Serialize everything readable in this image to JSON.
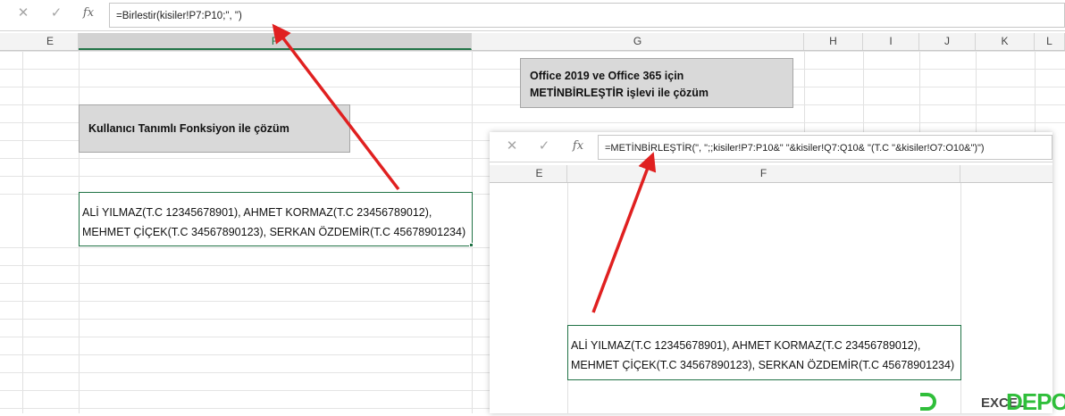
{
  "main_window": {
    "cancel_icon": "✕",
    "enter_icon": "✓",
    "fx_label": "fx",
    "formula": "=Birlestir(kisiler!P7:P10;\", \")",
    "columns": [
      "E",
      "F",
      "G",
      "H",
      "I",
      "J",
      "K",
      "L"
    ],
    "label_box": "Kullanıcı Tanımlı Fonksiyon ile çözüm",
    "result_line1": "ALİ YILMAZ(T.C 12345678901), AHMET KORMAZ(T.C 23456789012),",
    "result_line2": "MEHMET ÇİÇEK(T.C 34567890123), SERKAN ÖZDEMİR(T.C 45678901234)"
  },
  "office_box": {
    "line1": "Office 2019 ve Office 365 için",
    "line2": "METİNBİRLEŞTİR  işlevi ile çözüm"
  },
  "inset_window": {
    "cancel_icon": "✕",
    "enter_icon": "✓",
    "fx_label": "fx",
    "formula": "=METİNBİRLEŞTİR(\", \";;kisiler!P7:P10&\" \"&kisiler!Q7:Q10& \"(T.C \"&kisiler!O7:O10&\")\")",
    "columns": [
      "E",
      "F"
    ],
    "result_line1": "ALİ YILMAZ(T.C 12345678901), AHMET KORMAZ(T.C 23456789012),",
    "result_line2": "MEHMET ÇİÇEK(T.C 34567890123), SERKAN ÖZDEMİR(T.C 45678901234)"
  },
  "watermark": {
    "text": "DEPO",
    "sub": "EXCEL"
  },
  "colors": {
    "excel_green": "#217346",
    "arrow_red": "#e02020",
    "logo_green": "#2fbe3a"
  }
}
